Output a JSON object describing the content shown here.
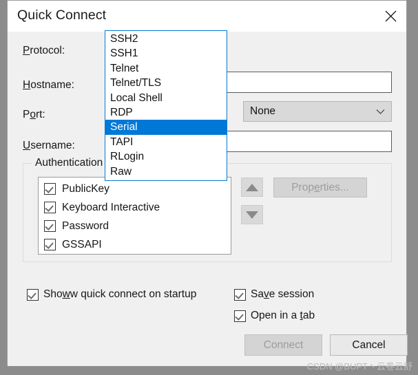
{
  "window": {
    "title": "Quick Connect",
    "close_icon": "close-icon"
  },
  "form": {
    "protocol": {
      "label_prefix": "",
      "label_accel": "P",
      "label_rest": "rotocol:",
      "value": "SSH2",
      "expanded": true,
      "options": [
        "SSH2",
        "SSH1",
        "Telnet",
        "Telnet/TLS",
        "Local Shell",
        "RDP",
        "Serial",
        "TAPI",
        "RLogin",
        "Raw"
      ],
      "highlighted_option": "Serial"
    },
    "hostname": {
      "label_accel": "H",
      "label_rest": "ostname:",
      "value": "",
      "placeholder": ""
    },
    "port": {
      "label_prefix": "P",
      "label_accel": "o",
      "label_rest": "rt:",
      "value": "",
      "placeholder": ""
    },
    "username": {
      "label_accel": "U",
      "label_rest": "sername:",
      "value": "",
      "placeholder": ""
    },
    "firewall": {
      "value": "None",
      "options": [
        "None"
      ]
    }
  },
  "authentication": {
    "group_title": "Authentication",
    "methods": [
      {
        "label": "PublicKey",
        "checked": true
      },
      {
        "label": "Keyboard Interactive",
        "checked": true
      },
      {
        "label": "Password",
        "checked": true
      },
      {
        "label": "GSSAPI",
        "checked": true
      }
    ],
    "move_up_icon": "arrow-up-icon",
    "move_down_icon": "arrow-down-icon",
    "properties_button": {
      "label_prefix": "Prop",
      "label_accel": "e",
      "label_rest": "rties...",
      "full_label": "Properties...",
      "enabled": false
    }
  },
  "options": {
    "show_on_startup": {
      "label_prefix": "Show quick connect on startup",
      "accel_char": "w",
      "checked": true
    },
    "save_session": {
      "label": "Save session",
      "accel_char": "v",
      "checked": true
    },
    "open_in_tab": {
      "label": "Open in a tab",
      "accel_char": "t",
      "checked": true
    }
  },
  "footer": {
    "connect_button": {
      "label": "Connect",
      "enabled": false
    },
    "cancel_button": {
      "label": "Cancel",
      "enabled": true
    }
  },
  "watermark": {
    "text": "CSDN @BUPT丶云卷云舒"
  },
  "colors": {
    "accent": "#0078d7",
    "combo_fill": "#cce4f7",
    "dialog_bg": "#f0f0f0",
    "desktop_bg": "#8c8c8c"
  }
}
